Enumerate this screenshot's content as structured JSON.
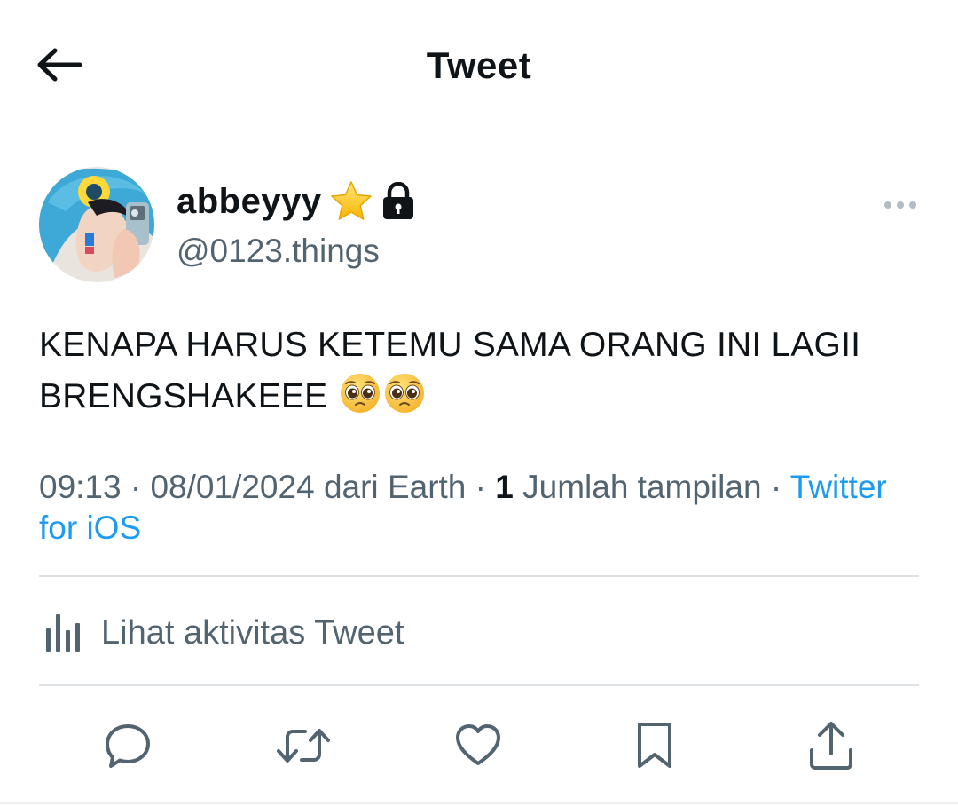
{
  "header": {
    "title": "Tweet",
    "back_icon": "arrow-left-icon"
  },
  "author": {
    "display_name": "abbeyyy",
    "badge_emoji": "star-icon",
    "protected_icon": "lock-icon",
    "handle": "@0123.things",
    "more_icon": "more-horizontal-icon"
  },
  "tweet": {
    "line1": "KENAPA HARUS KETEMU SAMA ORANG INI LAGII",
    "line2": "BRENGSHAKEEE",
    "emojis": [
      "pleading-face-icon",
      "pleading-face-icon"
    ]
  },
  "meta": {
    "time": "09:13",
    "date": "08/01/2024",
    "location_prefix": "dari",
    "location": "Earth",
    "view_count": "1",
    "view_label": "Jumlah tampilan",
    "source": "Twitter for iOS",
    "separator": "·"
  },
  "activity": {
    "label": "Lihat aktivitas Tweet",
    "icon": "analytics-bar-icon"
  },
  "actions": [
    "reply-icon",
    "retweet-icon",
    "like-icon",
    "bookmark-icon",
    "share-icon"
  ],
  "colors": {
    "text_primary": "#0f1419",
    "text_secondary": "#536471",
    "link": "#1d9bf0",
    "divider": "#dce2e6"
  }
}
